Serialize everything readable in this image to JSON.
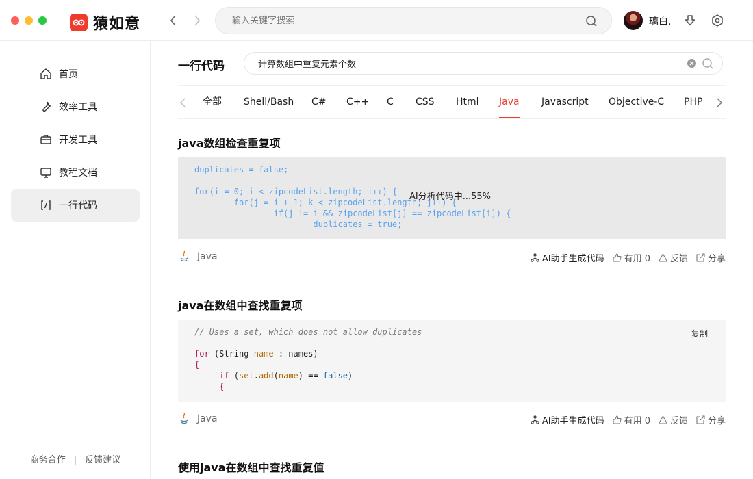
{
  "app": {
    "name": "猿如意"
  },
  "top_search": {
    "placeholder": "输入关键字搜索"
  },
  "user": {
    "name": "璃白."
  },
  "sidebar": {
    "items": [
      {
        "label": "首页",
        "icon": "home-icon"
      },
      {
        "label": "效率工具",
        "icon": "wrench-icon"
      },
      {
        "label": "开发工具",
        "icon": "briefcase-icon"
      },
      {
        "label": "教程文档",
        "icon": "monitor-icon"
      },
      {
        "label": "一行代码",
        "icon": "code-slash-icon",
        "active": true
      }
    ],
    "footer": {
      "business": "商务合作",
      "separator": "|",
      "feedback": "反馈建议"
    }
  },
  "main": {
    "title": "一行代码",
    "search_value": "计算数组中重复元素个数",
    "tabs": [
      {
        "label": "全部"
      },
      {
        "label": "Shell/Bash"
      },
      {
        "label": "C#"
      },
      {
        "label": "C++"
      },
      {
        "label": "C"
      },
      {
        "label": "CSS"
      },
      {
        "label": "Html"
      },
      {
        "label": "Java",
        "active": true
      },
      {
        "label": "Javascript"
      },
      {
        "label": "Objective-C"
      },
      {
        "label": "PHP"
      }
    ],
    "accent_color": "#e8412f",
    "snippets": [
      {
        "title": "java数组检查重复项",
        "ai_status": "AI分析代码中...55%",
        "code_lines": [
          "duplicates = false;",
          "",
          "for(i = 0; i < zipcodeList.length; i++) {",
          "        for(j = i + 1; k < zipcodeList.length; j++) {",
          "                if(j != i && zipcodeList[j] == zipcodeList[i]) {",
          "                        duplicates = true;"
        ],
        "language": "Java",
        "ai_generate": "AI助手生成代码",
        "useful": "有用 0",
        "feedback": "反馈",
        "share": "分享"
      },
      {
        "title": "java在数组中查找重复项",
        "copy_label": "复制",
        "code": {
          "comment": "// Uses a set, which does not allow duplicates",
          "line2_kw": "for",
          "line2_a": " (String ",
          "line2_var": "name",
          "line2_b": " : names)",
          "line3": "{",
          "line4_kw": "if",
          "line4_a": " (",
          "line4_set": "set",
          "line4_dot": ".",
          "line4_fn": "add",
          "line4_b": "(",
          "line4_var": "name",
          "line4_c": ") == ",
          "line4_bool": "false",
          "line4_d": ")",
          "line5": "{"
        },
        "language": "Java",
        "ai_generate": "AI助手生成代码",
        "useful": "有用 0",
        "feedback": "反馈",
        "share": "分享"
      },
      {
        "title": "使用java在数组中查找重复值"
      }
    ]
  }
}
